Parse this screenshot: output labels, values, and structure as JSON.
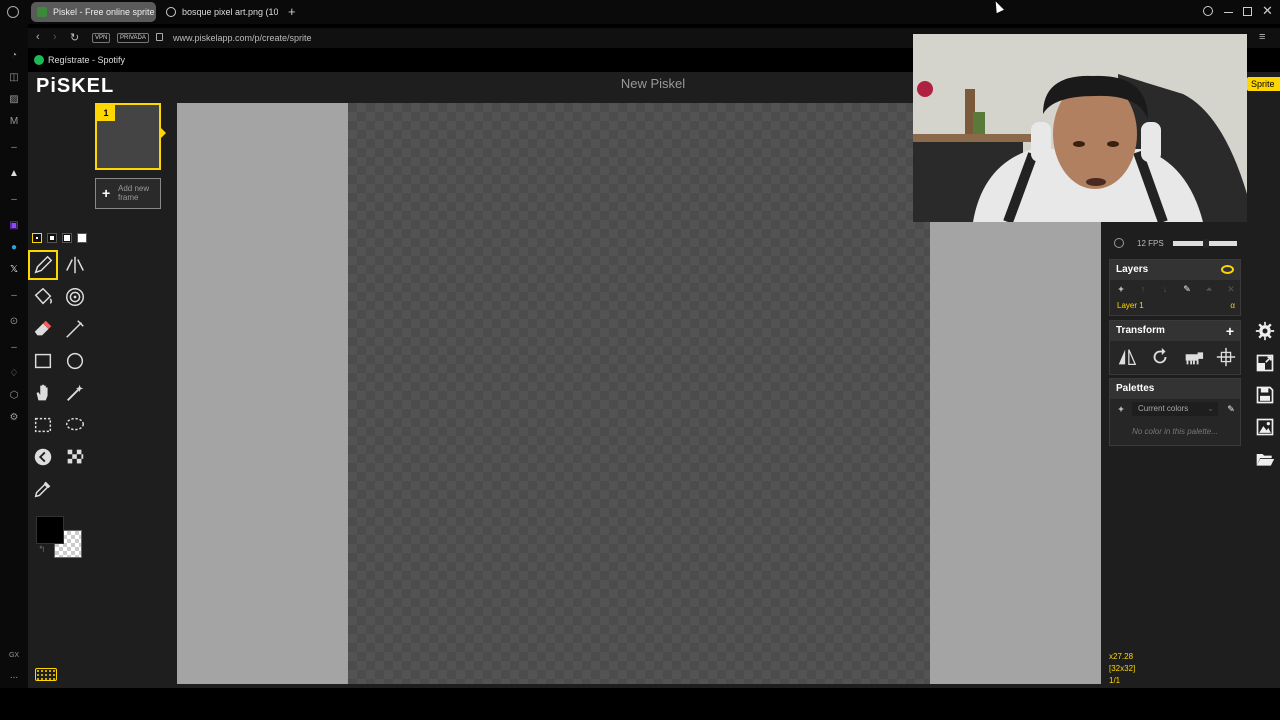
{
  "browser": {
    "tabs": [
      {
        "title": "Piskel - Free online sprite",
        "active": true
      },
      {
        "title": "bosque pixel art.png (102",
        "active": false
      }
    ],
    "new_tab_symbol": "+",
    "address": {
      "vpn_badge": "VPN",
      "private_badge": "PRIVADA",
      "url": "www.piskelapp.com/p/create/sprite"
    },
    "bookmark": {
      "label": "Regístrate - Spotify"
    }
  },
  "sidebar": {
    "icons": [
      "speed-dial-icon",
      "history-icon",
      "messenger-icon",
      "gmail-icon",
      "dash-icon",
      "aria-icon",
      "dash-icon",
      "twitch-icon",
      "telegram-icon",
      "x-icon",
      "dash-icon",
      "player-icon",
      "dash-icon",
      "pin-icon",
      "extensions-icon",
      "settings-icon"
    ],
    "bottom_label": "GX",
    "more_label": "..."
  },
  "piskel": {
    "logo": "PiSKEL",
    "title": "New Piskel",
    "frames": [
      {
        "number": "1"
      }
    ],
    "add_frame_label": "Add new frame",
    "pen_sizes": [
      1,
      2,
      3,
      4
    ],
    "primary_color": "#000000",
    "secondary_color": "transparent",
    "fps_label": "12 FPS",
    "layers": {
      "title": "Layers",
      "items": [
        {
          "name": "Layer 1",
          "alpha_symbol": "α"
        }
      ]
    },
    "transform": {
      "title": "Transform"
    },
    "palettes": {
      "title": "Palettes",
      "selected": "Current colors",
      "empty_message": "No color in this palette..."
    },
    "resize_tab": "Sprite",
    "status": {
      "cursor": "x27.28",
      "size": "[32x32]",
      "frame": "1/1"
    },
    "accent_color": "#ffd700"
  }
}
